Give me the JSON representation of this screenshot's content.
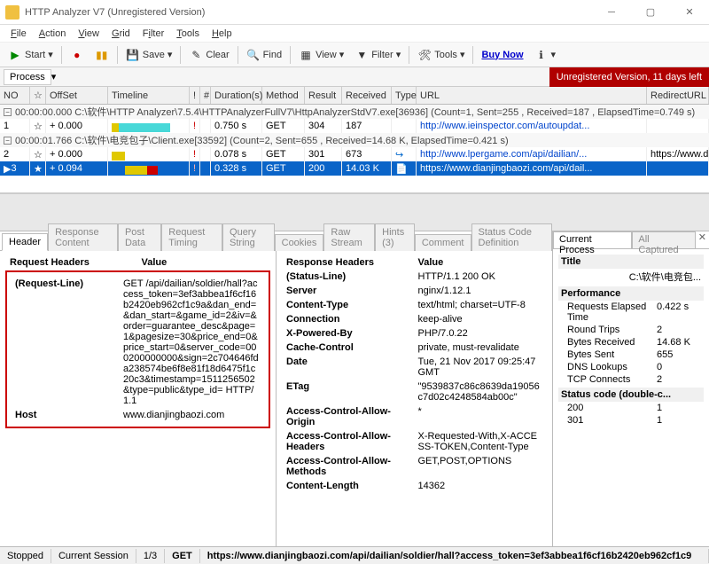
{
  "window": {
    "title": "HTTP Analyzer V7  (Unregistered Version)"
  },
  "menubar": [
    "File",
    "Action",
    "View",
    "Grid",
    "Filter",
    "Tools",
    "Help"
  ],
  "toolbar": {
    "start": "Start",
    "save": "Save",
    "clear": "Clear",
    "find": "Find",
    "view": "View",
    "filter": "Filter",
    "tools": "Tools",
    "buynow": "Buy Now"
  },
  "processbar": {
    "label": "Process",
    "unregistered": "Unregistered Version, 11 days left"
  },
  "columns": {
    "no": "NO",
    "offset": "OffSet",
    "timeline": "Timeline",
    "bang": "!",
    "hash": "#",
    "duration": "Duration(s)",
    "method": "Method",
    "result": "Result",
    "received": "Received",
    "type": "Type",
    "url": "URL",
    "redirect": "RedirectURL"
  },
  "groups": [
    {
      "text": "00:00:00.000  C:\\软件\\HTTP Analyzer\\7.5.4\\HTTPAnalyzerFullV7\\HttpAnalyzerStdV7.exe[36936]  (Count=1, Sent=255 , Received=187 , ElapsedTime=0.749 s)"
    },
    {
      "text": "00:00:01.766  C:\\软件\\电竞包子\\Client.exe[33592]  (Count=2, Sent=655 , Received=14.68 K, ElapsedTime=0.421 s)"
    }
  ],
  "rows": [
    {
      "no": "1",
      "offset": "+ 0.000",
      "dur": "0.750 s",
      "method": "GET",
      "result": "304",
      "recv": "187",
      "url": "http://www.ieinspector.com/autoupdat...",
      "sel": false
    },
    {
      "no": "2",
      "offset": "+ 0.000",
      "dur": "0.078 s",
      "method": "GET",
      "result": "301",
      "recv": "673",
      "url": "http://www.lpergame.com/api/dailian/...",
      "redir": "https://www.dianjing...",
      "sel": false
    },
    {
      "no": "3",
      "offset": "+ 0.094",
      "dur": "0.328 s",
      "method": "GET",
      "result": "200",
      "recv": "14.03 K",
      "url": "https://www.dianjingbaozi.com/api/dail...",
      "sel": true
    }
  ],
  "leftTabs": [
    "Header",
    "Response Content",
    "Post Data",
    "Request Timing",
    "Query String",
    "Cookies",
    "Raw Stream",
    "Hints (3)",
    "Comment",
    "Status Code Definition"
  ],
  "reqHeaders": {
    "title": "Request Headers",
    "valcol": "Value",
    "requestLineLabel": "(Request-Line)",
    "requestLine": "GET /api/dailian/soldier/hall?access_token=3ef3abbea1f6cf16b2420eb962cf1c9a&dan_end=&dan_start=&game_id=2&iv=&order=guarantee_desc&page=1&pagesize=30&price_end=0&price_start=0&server_code=000200000000&sign=2c704646fda238574be6f8e81f18d6475f1c20c3&timestamp=1511256502&type=public&type_id= HTTP/1.1",
    "hostLabel": "Host",
    "host": "www.dianjingbaozi.com"
  },
  "respHeaders": {
    "title": "Response Headers",
    "valcol": "Value",
    "items": [
      [
        "(Status-Line)",
        "HTTP/1.1 200 OK"
      ],
      [
        "Server",
        "nginx/1.12.1"
      ],
      [
        "Content-Type",
        "text/html; charset=UTF-8"
      ],
      [
        "Connection",
        "keep-alive"
      ],
      [
        "X-Powered-By",
        "PHP/7.0.22"
      ],
      [
        "Cache-Control",
        "private, must-revalidate"
      ],
      [
        "Date",
        "Tue, 21 Nov 2017 09:25:47 GMT"
      ],
      [
        "ETag",
        "\"9539837c86c8639da19056c7d02c4248584ab00c\""
      ],
      [
        "Access-Control-Allow-Origin",
        "*"
      ],
      [
        "Access-Control-Allow-Headers",
        "X-Requested-With,X-ACCESS-TOKEN,Content-Type"
      ],
      [
        "Access-Control-Allow-Methods",
        "GET,POST,OPTIONS"
      ],
      [
        "Content-Length",
        "14362"
      ]
    ]
  },
  "rightTabs": {
    "cur": "Current Process",
    "all": "All Captured"
  },
  "rightProps": {
    "titleHdr": "Title",
    "titleVal": "C:\\软件\\电竞包...",
    "perfHdr": "Performance",
    "perf": [
      [
        "Requests Elapsed Time",
        "0.422 s"
      ],
      [
        "Round Trips",
        "2"
      ],
      [
        "Bytes Received",
        "14.68 K"
      ],
      [
        "Bytes Sent",
        "655"
      ],
      [
        "DNS Lookups",
        "0"
      ],
      [
        "TCP Connects",
        "2"
      ]
    ],
    "statusHdr": "Status code (double-c...",
    "status": [
      [
        "200",
        "1"
      ],
      [
        "301",
        "1"
      ]
    ]
  },
  "statusbar": {
    "stopped": "Stopped",
    "session": "Current Session",
    "count": "1/3",
    "method": "GET",
    "url": "https://www.dianjingbaozi.com/api/dailian/soldier/hall?access_token=3ef3abbea1f6cf16b2420eb962cf1c9"
  }
}
